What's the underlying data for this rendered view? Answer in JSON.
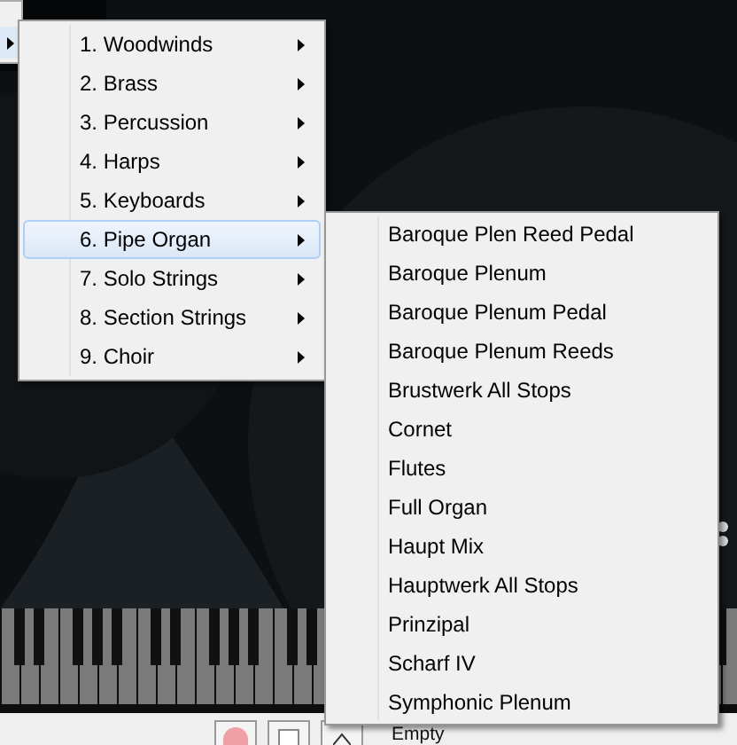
{
  "instrument_menu": [
    {
      "label": "1. Woodwinds",
      "selected": false,
      "has_submenu": true
    },
    {
      "label": "2. Brass",
      "selected": false,
      "has_submenu": true
    },
    {
      "label": "3. Percussion",
      "selected": false,
      "has_submenu": true
    },
    {
      "label": "4. Harps",
      "selected": false,
      "has_submenu": true
    },
    {
      "label": "5. Keyboards",
      "selected": false,
      "has_submenu": true
    },
    {
      "label": "6. Pipe Organ",
      "selected": true,
      "has_submenu": true
    },
    {
      "label": "7. Solo Strings",
      "selected": false,
      "has_submenu": true
    },
    {
      "label": "8. Section Strings",
      "selected": false,
      "has_submenu": true
    },
    {
      "label": "9. Choir",
      "selected": false,
      "has_submenu": true
    }
  ],
  "pipe_organ_submenu": [
    {
      "label": "Baroque Plen Reed Pedal"
    },
    {
      "label": "Baroque Plenum"
    },
    {
      "label": "Baroque Plenum Pedal"
    },
    {
      "label": "Baroque Plenum Reeds"
    },
    {
      "label": "Brustwerk All Stops"
    },
    {
      "label": "Cornet"
    },
    {
      "label": "Flutes"
    },
    {
      "label": "Full Organ"
    },
    {
      "label": "Haupt Mix"
    },
    {
      "label": "Hauptwerk All Stops"
    },
    {
      "label": "Prinzipal"
    },
    {
      "label": "Scharf IV"
    },
    {
      "label": "Symphonic Plenum"
    }
  ],
  "status_text": "Empty"
}
